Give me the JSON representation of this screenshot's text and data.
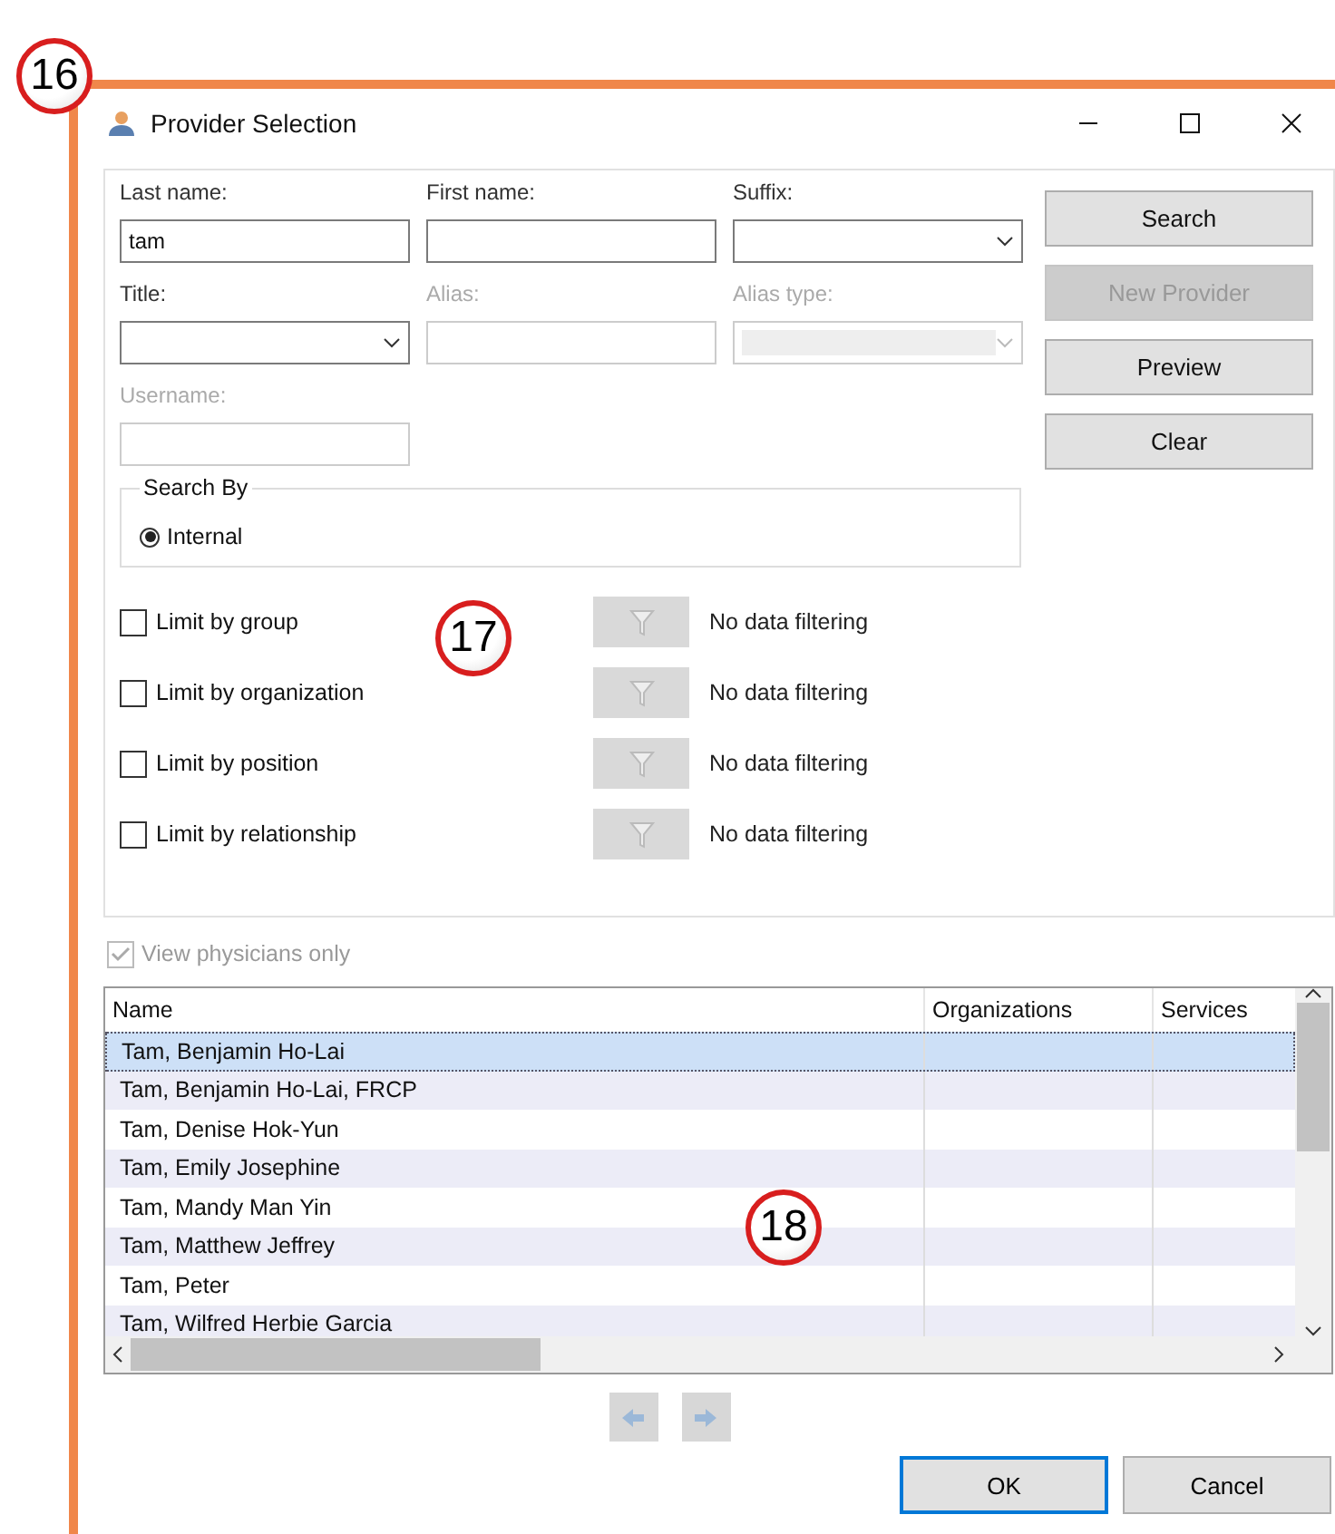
{
  "callouts": [
    "16",
    "17",
    "18"
  ],
  "window": {
    "title": "Provider Selection"
  },
  "fields": [
    {
      "label": "Last name:",
      "kind": "text",
      "value": "tam",
      "disabled": false
    },
    {
      "label": "First name:",
      "kind": "text",
      "disabled": false
    },
    {
      "label": "Suffix:",
      "kind": "combo",
      "disabled": false
    },
    {
      "label": "Title:",
      "kind": "combo",
      "disabled": false
    },
    {
      "label": "Alias:",
      "kind": "text",
      "disabled": true
    },
    {
      "label": "Alias type:",
      "kind": "combo",
      "disabled": true
    },
    {
      "label": "Username:",
      "kind": "text",
      "disabled": true
    }
  ],
  "actions": [
    {
      "label": "Search",
      "disabled": false
    },
    {
      "label": "New Provider",
      "disabled": true
    },
    {
      "label": "Preview",
      "disabled": false
    },
    {
      "label": "Clear",
      "disabled": false
    }
  ],
  "search_by": {
    "legend": "Search By",
    "options": [
      {
        "label": "Internal",
        "selected": true
      }
    ]
  },
  "limits": [
    {
      "label": "Limit by group",
      "checked": false,
      "status": "No data filtering"
    },
    {
      "label": "Limit by organization",
      "checked": false,
      "status": "No data filtering"
    },
    {
      "label": "Limit by position",
      "checked": false,
      "status": "No data filtering"
    },
    {
      "label": "Limit by relationship",
      "checked": false,
      "status": "No data filtering"
    }
  ],
  "view_physicians": {
    "label": "View physicians only",
    "checked": true,
    "disabled": true
  },
  "table": {
    "columns": [
      "Name",
      "Organizations",
      "Services"
    ],
    "rows": [
      {
        "name": "Tam, Benjamin Ho-Lai",
        "selected": true
      },
      {
        "name": "Tam, Benjamin Ho-Lai, FRCP",
        "selected": false
      },
      {
        "name": "Tam, Denise Hok-Yun",
        "selected": false
      },
      {
        "name": "Tam, Emily Josephine",
        "selected": false
      },
      {
        "name": "Tam, Mandy Man Yin",
        "selected": false
      },
      {
        "name": "Tam, Matthew Jeffrey",
        "selected": false
      },
      {
        "name": "Tam, Peter",
        "selected": false
      },
      {
        "name": "Tam, Wilfred Herbie Garcia",
        "selected": false
      }
    ]
  },
  "nav_buttons": [
    {
      "kind": "back",
      "disabled": true
    },
    {
      "kind": "forward",
      "disabled": true
    }
  ],
  "dialog_buttons": [
    {
      "label": "OK",
      "default": true
    },
    {
      "label": "Cancel",
      "default": false
    }
  ]
}
